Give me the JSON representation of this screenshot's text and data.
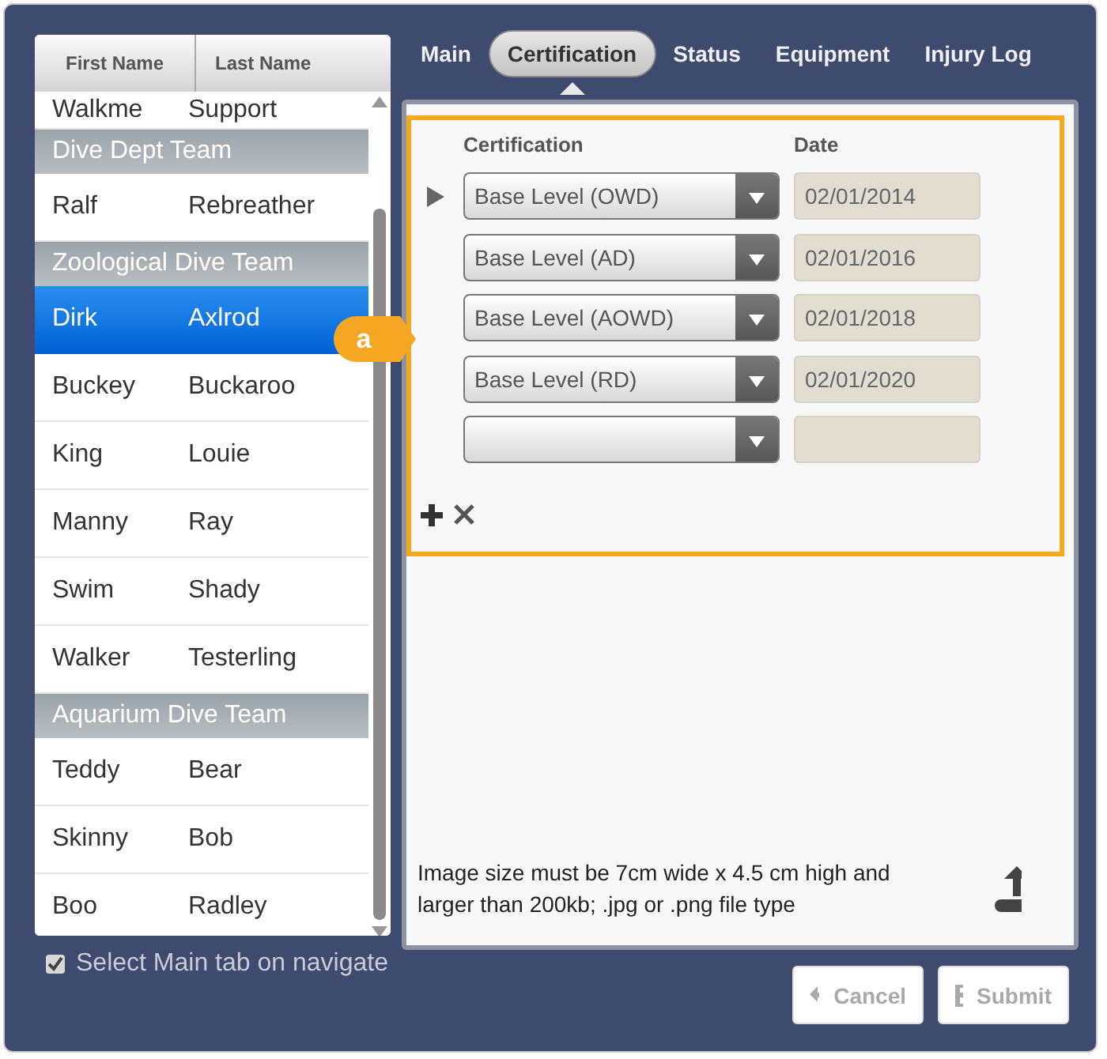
{
  "people_list": {
    "columns": [
      "First Name",
      "Last Name"
    ],
    "rows": [
      {
        "kind": "person",
        "first": "Walkme",
        "last": "Support",
        "selected": false
      },
      {
        "kind": "group",
        "label": "Dive Dept Team"
      },
      {
        "kind": "person",
        "first": "Ralf",
        "last": "Rebreather",
        "selected": false
      },
      {
        "kind": "group",
        "label": "Zoological Dive Team"
      },
      {
        "kind": "person",
        "first": "Dirk",
        "last": "Axlrod",
        "selected": true
      },
      {
        "kind": "person",
        "first": "Buckey",
        "last": "Buckaroo",
        "selected": false
      },
      {
        "kind": "person",
        "first": "King",
        "last": "Louie",
        "selected": false
      },
      {
        "kind": "person",
        "first": "Manny",
        "last": "Ray",
        "selected": false
      },
      {
        "kind": "person",
        "first": "Swim",
        "last": "Shady",
        "selected": false
      },
      {
        "kind": "person",
        "first": "Walker",
        "last": "Testerling",
        "selected": false
      },
      {
        "kind": "group",
        "label": "Aquarium Dive Team"
      },
      {
        "kind": "person",
        "first": "Teddy",
        "last": "Bear",
        "selected": false
      },
      {
        "kind": "person",
        "first": "Skinny",
        "last": "Bob",
        "selected": false
      },
      {
        "kind": "person",
        "first": "Boo",
        "last": "Radley",
        "selected": false
      }
    ]
  },
  "select_main_tab": {
    "label": "Select Main tab on navigate",
    "checked": true
  },
  "tabs": [
    {
      "label": "Main",
      "selected": false
    },
    {
      "label": "Certification",
      "selected": true
    },
    {
      "label": "Status",
      "selected": false
    },
    {
      "label": "Equipment",
      "selected": false
    },
    {
      "label": "Injury Log",
      "selected": false
    }
  ],
  "callout": {
    "label": "a"
  },
  "certifications": {
    "columns": [
      "Certification",
      "Date"
    ],
    "rows": [
      {
        "certification": "Base Level (OWD)",
        "date": "02/01/2014",
        "current": true
      },
      {
        "certification": "Base Level (AD)",
        "date": "02/01/2016",
        "current": false
      },
      {
        "certification": "Base Level (AOWD)",
        "date": "02/01/2018",
        "current": false
      },
      {
        "certification": "Base Level (RD)",
        "date": "02/01/2020",
        "current": false
      },
      {
        "current": false
      }
    ]
  },
  "image_note": "Image size must be 7cm wide x 4.5 cm high and larger than 200kb; .jpg or .png file type",
  "buttons": [
    {
      "kind": "cancel",
      "label": "Cancel",
      "disabled": true
    },
    {
      "kind": "submit",
      "label": "Submit",
      "disabled": true
    }
  ]
}
